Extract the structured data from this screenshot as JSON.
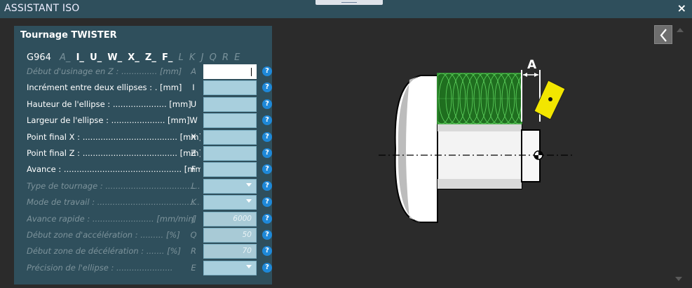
{
  "window": {
    "title": "ASSISTANT ISO",
    "close_glyph": "×"
  },
  "panel": {
    "title": "Tournage TWISTER",
    "gcode": {
      "command": "G964",
      "params": [
        {
          "text": "A_",
          "active": false
        },
        {
          "text": "I_",
          "active": true
        },
        {
          "text": "U_",
          "active": true
        },
        {
          "text": "W_",
          "active": true
        },
        {
          "text": "X_",
          "active": true
        },
        {
          "text": "Z_",
          "active": true
        },
        {
          "text": "F_",
          "active": true
        },
        {
          "text": "L",
          "active": false
        },
        {
          "text": "K",
          "active": false
        },
        {
          "text": "J",
          "active": false
        },
        {
          "text": "Q",
          "active": false
        },
        {
          "text": "R",
          "active": false
        },
        {
          "text": "E",
          "active": false
        }
      ]
    },
    "rows": [
      {
        "label": "Début d'usinage en Z : .............. [mm]",
        "letter": "A",
        "active": false,
        "field": "white",
        "value": ""
      },
      {
        "label": "Incrément entre deux ellipses : . [mm]",
        "letter": "I",
        "active": true,
        "field": "input",
        "value": ""
      },
      {
        "label": "Hauteur de l'ellipse : ..................... [mm]",
        "letter": "U",
        "active": true,
        "field": "input",
        "value": ""
      },
      {
        "label": "Largeur de l'ellipse : ..................... [mm]",
        "letter": "W",
        "active": true,
        "field": "input",
        "value": ""
      },
      {
        "label": "Point final X : ..................................... [mm]",
        "letter": "X",
        "active": true,
        "field": "input",
        "value": ""
      },
      {
        "label": "Point final Z : ..................................... [mm]",
        "letter": "Z",
        "active": true,
        "field": "input",
        "value": ""
      },
      {
        "label": "Avance : .............................................. [mm/tr]",
        "letter": "F",
        "active": true,
        "field": "input",
        "value": ""
      },
      {
        "label": "Type de tournage : .......................................",
        "letter": "L",
        "active": false,
        "field": "select",
        "value": ""
      },
      {
        "label": "Mode de travail : ..............................................",
        "letter": "K",
        "active": false,
        "field": "select",
        "value": ""
      },
      {
        "label": "Avance rapide : ........................ [mm/min]",
        "letter": "J",
        "active": false,
        "field": "disabled",
        "value": "6000"
      },
      {
        "label": "Début zone d'accélération : ......... [%]",
        "letter": "Q",
        "active": false,
        "field": "disabled",
        "value": "50"
      },
      {
        "label": "Début zone de décélération : ....... [%]",
        "letter": "R",
        "active": false,
        "field": "disabled",
        "value": "70"
      },
      {
        "label": "Précision de l'ellipse : ......................",
        "letter": "E",
        "active": false,
        "field": "select",
        "value": ""
      }
    ],
    "help_glyph": "?"
  },
  "drawing": {
    "dimension_label": "A",
    "colors": {
      "ellipses": "#3aa53a",
      "insert": "#f2e600",
      "part": "#ffffff"
    }
  },
  "nav": {
    "back_glyph": "❮"
  }
}
